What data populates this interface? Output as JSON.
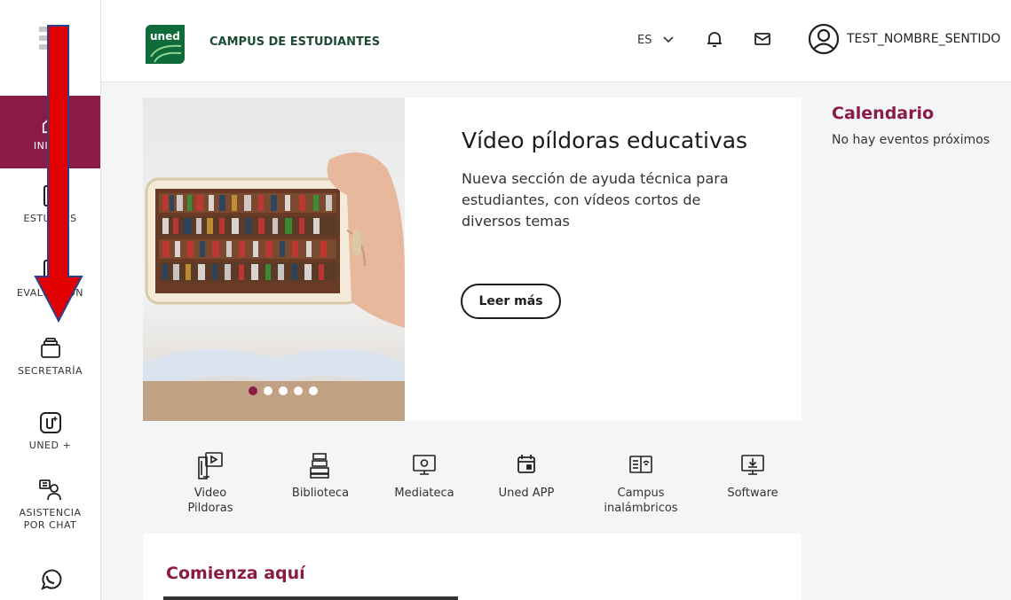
{
  "header": {
    "logo_text": "uned",
    "brand": "CAMPUS DE ESTUDIANTES",
    "lang": "ES",
    "user_name": "TEST_NOMBRE_SENTIDO"
  },
  "sidebar": {
    "items": [
      {
        "label": "INICIO",
        "icon": "home-icon"
      },
      {
        "label": "ESTUDIOS",
        "icon": "book-icon"
      },
      {
        "label": "EVALUACIÓN",
        "icon": "evaluation-icon"
      },
      {
        "label": "SECRETARÍA",
        "icon": "folder-icon"
      },
      {
        "label": "UNED +",
        "icon": "uned-plus-icon"
      },
      {
        "label_line1": "ASISTENCIA",
        "label_line2": "POR CHAT",
        "icon": "chat-assistance-icon"
      },
      {
        "label": "",
        "icon": "whatsapp-icon"
      }
    ]
  },
  "hero": {
    "title": "Vídeo píldoras educativas",
    "description": "Nueva sección de ayuda técnica para estudiantes, con vídeos cortos de diversos temas",
    "button": "Leer más",
    "slides_count": 5,
    "active_slide": 1
  },
  "quick_links": [
    {
      "line1": "Video",
      "line2": "Pildoras",
      "icon": "video-pills-icon"
    },
    {
      "line1": "Biblioteca",
      "line2": "",
      "icon": "library-icon"
    },
    {
      "line1": "Mediateca",
      "line2": "",
      "icon": "media-icon"
    },
    {
      "line1": "Uned APP",
      "line2": "",
      "icon": "calendar-app-icon"
    },
    {
      "line1": "Campus",
      "line2": "inalámbricos",
      "icon": "wifi-book-icon"
    },
    {
      "line1": "Software",
      "line2": "",
      "icon": "software-download-icon"
    }
  ],
  "calendar": {
    "title": "Calendario",
    "text": "No hay eventos próximos"
  },
  "start": {
    "title": "Comienza aquí"
  },
  "colors": {
    "accent": "#8a1b45",
    "brand_green": "#0f6b3a",
    "arrow": "#e00000"
  }
}
